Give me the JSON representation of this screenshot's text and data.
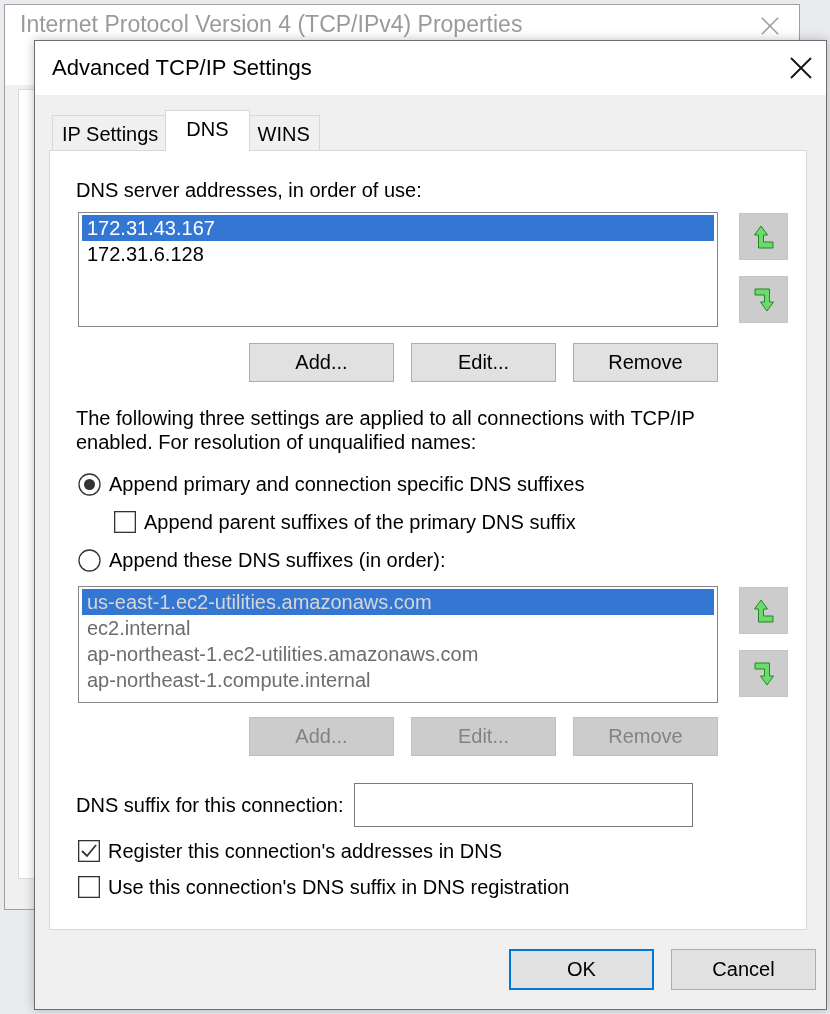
{
  "background_window": {
    "title": "Internet Protocol Version 4 (TCP/IPv4) Properties"
  },
  "dialog": {
    "title": "Advanced TCP/IP Settings"
  },
  "tabs": [
    {
      "label": "IP Settings",
      "selected": false
    },
    {
      "label": "DNS",
      "selected": true
    },
    {
      "label": "WINS",
      "selected": false
    }
  ],
  "dns_servers": {
    "label": "DNS server addresses, in order of use:",
    "items": [
      {
        "text": "172.31.43.167",
        "selected": true
      },
      {
        "text": "172.31.6.128",
        "selected": false
      }
    ],
    "buttons": [
      {
        "label": "Add...",
        "disabled": false
      },
      {
        "label": "Edit...",
        "disabled": false
      },
      {
        "label": "Remove",
        "disabled": false
      }
    ]
  },
  "resolution_note": "The following three settings are applied to all connections with TCP/IP enabled. For resolution of unqualified names:",
  "options": [
    {
      "kind": "radio",
      "label": "Append primary and connection specific DNS suffixes",
      "selected": true,
      "children": [
        {
          "kind": "checkbox",
          "label": "Append parent suffixes of the primary DNS suffix",
          "checked": false
        }
      ]
    },
    {
      "kind": "radio",
      "label": "Append these DNS suffixes (in order):",
      "selected": false
    }
  ],
  "dns_suffixes": {
    "disabled": true,
    "items": [
      {
        "text": "us-east-1.ec2-utilities.amazonaws.com",
        "selected": true
      },
      {
        "text": "ec2.internal",
        "selected": false
      },
      {
        "text": "ap-northeast-1.ec2-utilities.amazonaws.com",
        "selected": false
      },
      {
        "text": "ap-northeast-1.compute.internal",
        "selected": false
      }
    ],
    "buttons": [
      {
        "label": "Add...",
        "disabled": true
      },
      {
        "label": "Edit...",
        "disabled": true
      },
      {
        "label": "Remove",
        "disabled": true
      }
    ]
  },
  "connection_suffix": {
    "label": "DNS suffix for this connection:"
  },
  "registration": [
    {
      "label": "Register this connection's addresses in DNS",
      "checked": true
    },
    {
      "label": "Use this connection's DNS suffix in DNS registration",
      "checked": false
    }
  ],
  "footer_buttons": [
    {
      "label": "OK",
      "default": true
    },
    {
      "label": "Cancel",
      "default": false
    }
  ]
}
